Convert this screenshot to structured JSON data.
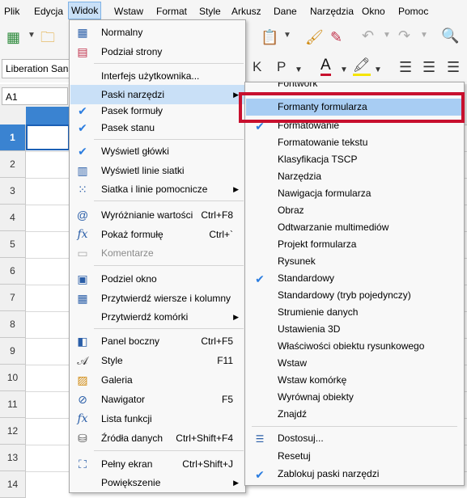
{
  "menubar": {
    "items": [
      "Plik",
      "Edycja",
      "Widok",
      "Wstaw",
      "Format",
      "Style",
      "Arkusz",
      "Dane",
      "Narzędzia",
      "Okno",
      "Pomoc"
    ]
  },
  "toolbar": {
    "font_name": "Liberation Sans",
    "bold_label": "K",
    "italic_label": "P",
    "font_color_label": "A"
  },
  "formula_bar": {
    "name_box": "A1"
  },
  "sheet": {
    "rows": [
      "1",
      "2",
      "3",
      "4",
      "5",
      "6",
      "7",
      "8",
      "9",
      "10",
      "11",
      "12",
      "13",
      "14"
    ]
  },
  "view_menu": {
    "items": [
      {
        "label": "Normalny",
        "icon": "normal-view-icon"
      },
      {
        "label": "Podział strony",
        "icon": "page-break-icon"
      },
      {
        "label": "Interfejs użytkownika...",
        "icon": ""
      },
      {
        "label": "Paski narzędzi",
        "icon": "",
        "submenu": true
      },
      {
        "label": "Pasek formuły",
        "icon": "check-icon"
      },
      {
        "label": "Pasek stanu",
        "icon": "check-icon"
      },
      {
        "label": "Wyświetl główki",
        "icon": "check-icon"
      },
      {
        "label": "Wyświetl linie siatki",
        "icon": "grid-lines-icon"
      },
      {
        "label": "Siatka i linie pomocnicze",
        "icon": "grid-dots-icon",
        "submenu": true
      },
      {
        "label": "Wyróżnianie wartości",
        "icon": "value-highlight-icon",
        "shortcut": "Ctrl+F8"
      },
      {
        "label": "Pokaż formułę",
        "icon": "fx-icon",
        "shortcut": "Ctrl+`"
      },
      {
        "label": "Komentarze",
        "icon": "comment-icon"
      },
      {
        "label": "Podziel okno",
        "icon": "split-window-icon"
      },
      {
        "label": "Przytwierdź wiersze i kolumny",
        "icon": "freeze-icon"
      },
      {
        "label": "Przytwierdź komórki",
        "icon": "",
        "submenu": true
      },
      {
        "label": "Panel boczny",
        "icon": "sidebar-icon",
        "shortcut": "Ctrl+F5"
      },
      {
        "label": "Style",
        "icon": "styles-icon",
        "shortcut": "F11"
      },
      {
        "label": "Galeria",
        "icon": "gallery-icon"
      },
      {
        "label": "Nawigator",
        "icon": "navigator-icon",
        "shortcut": "F5"
      },
      {
        "label": "Lista funkcji",
        "icon": "function-list-icon"
      },
      {
        "label": "Źródła danych",
        "icon": "data-sources-icon",
        "shortcut": "Ctrl+Shift+F4"
      },
      {
        "label": "Pełny ekran",
        "icon": "fullscreen-icon",
        "shortcut": "Ctrl+Shift+J"
      },
      {
        "label": "Powiększenie",
        "icon": "",
        "submenu": true
      }
    ]
  },
  "toolbars_submenu": {
    "items": [
      {
        "label": "Formanty formularza",
        "checked": false
      },
      {
        "label": "Formatowanie",
        "checked": true
      },
      {
        "label": "Formatowanie tekstu",
        "checked": false
      },
      {
        "label": "Klasyfikacja TSCP",
        "checked": false
      },
      {
        "label": "Narzędzia",
        "checked": false
      },
      {
        "label": "Nawigacja formularza",
        "checked": false
      },
      {
        "label": "Obraz",
        "checked": false
      },
      {
        "label": "Odtwarzanie multimediów",
        "checked": false
      },
      {
        "label": "Projekt formularza",
        "checked": false
      },
      {
        "label": "Rysunek",
        "checked": false
      },
      {
        "label": "Standardowy",
        "checked": true
      },
      {
        "label": "Standardowy (tryb pojedynczy)",
        "checked": false
      },
      {
        "label": "Strumienie danych",
        "checked": false
      },
      {
        "label": "Ustawienia 3D",
        "checked": false
      },
      {
        "label": "Właściwości obiektu rysunkowego",
        "checked": false
      },
      {
        "label": "Wstaw",
        "checked": false
      },
      {
        "label": "Wstaw komórkę",
        "checked": false
      },
      {
        "label": "Wyrównaj obiekty",
        "checked": false
      },
      {
        "label": "Znajdź",
        "checked": false
      },
      {
        "label": "Dostosuj...",
        "checked": false
      },
      {
        "label": "Resetuj",
        "checked": false
      },
      {
        "label": "Zablokuj paski narzędzi",
        "checked": true
      }
    ],
    "partial_top_label": "Fontwork"
  },
  "colors": {
    "highlight": "#c9e0f7",
    "selected_submenu": "#a8cdf3",
    "annotation_red": "#c8102e",
    "accent_blue": "#3a83d1"
  }
}
